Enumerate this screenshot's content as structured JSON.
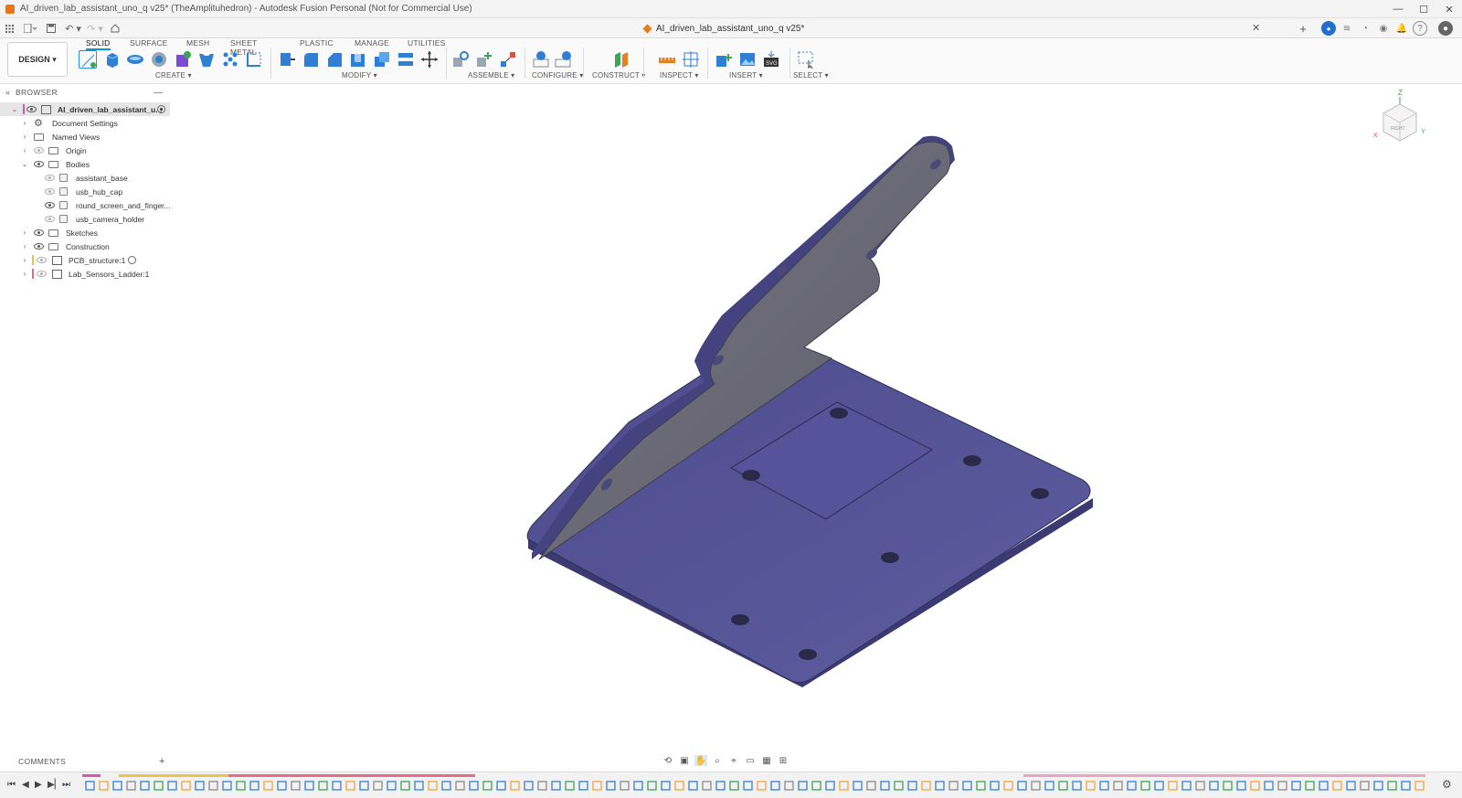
{
  "window": {
    "title": "AI_driven_lab_assistant_uno_q v25* (TheAmplituhedron) - Autodesk Fusion Personal (Not for Commercial Use)",
    "controls": [
      "—",
      "☐",
      "✕"
    ]
  },
  "document_tab": {
    "label": "AI_driven_lab_assistant_uno_q v25*",
    "close": "✕"
  },
  "workspace": {
    "label": "DESIGN ▾"
  },
  "tabs": [
    {
      "label": "SOLID",
      "active": true
    },
    {
      "label": "SURFACE",
      "active": false
    },
    {
      "label": "MESH",
      "active": false
    },
    {
      "label": "SHEET METAL",
      "active": false
    },
    {
      "label": "PLASTIC",
      "active": false
    },
    {
      "label": "MANAGE",
      "active": false
    },
    {
      "label": "UTILITIES",
      "active": false
    }
  ],
  "tool_groups": [
    {
      "label": "CREATE ▾"
    },
    {
      "label": "MODIFY ▾"
    },
    {
      "label": "ASSEMBLE ▾"
    },
    {
      "label": "CONFIGURE ▾"
    },
    {
      "label": "CONSTRUCT ▾"
    },
    {
      "label": "INSPECT ▾"
    },
    {
      "label": "INSERT ▾"
    },
    {
      "label": "SELECT ▾"
    }
  ],
  "browser": {
    "title": "BROWSER",
    "items": [
      {
        "label": "AI_driven_lab_assistant_u...",
        "kind": "root"
      },
      {
        "label": "Document Settings",
        "kind": "settings"
      },
      {
        "label": "Named Views",
        "kind": "folder"
      },
      {
        "label": "Origin",
        "kind": "folder"
      },
      {
        "label": "Bodies",
        "kind": "folder"
      },
      {
        "label": "assistant_base",
        "kind": "body"
      },
      {
        "label": "usb_hub_cap",
        "kind": "body"
      },
      {
        "label": "round_screen_and_finger...",
        "kind": "body"
      },
      {
        "label": "usb_camera_holder",
        "kind": "body"
      },
      {
        "label": "Sketches",
        "kind": "folder"
      },
      {
        "label": "Construction",
        "kind": "folder"
      },
      {
        "label": "PCB_structure:1",
        "kind": "component"
      },
      {
        "label": "Lab_Sensors_Ladder:1",
        "kind": "component"
      }
    ]
  },
  "comments": {
    "label": "COMMENTS",
    "add": "+"
  },
  "colors": {
    "accent": "#0696d7",
    "model_top": "#5a5a9c",
    "model_side": "#3e3c78",
    "panel_face": "#6c6b7a"
  }
}
